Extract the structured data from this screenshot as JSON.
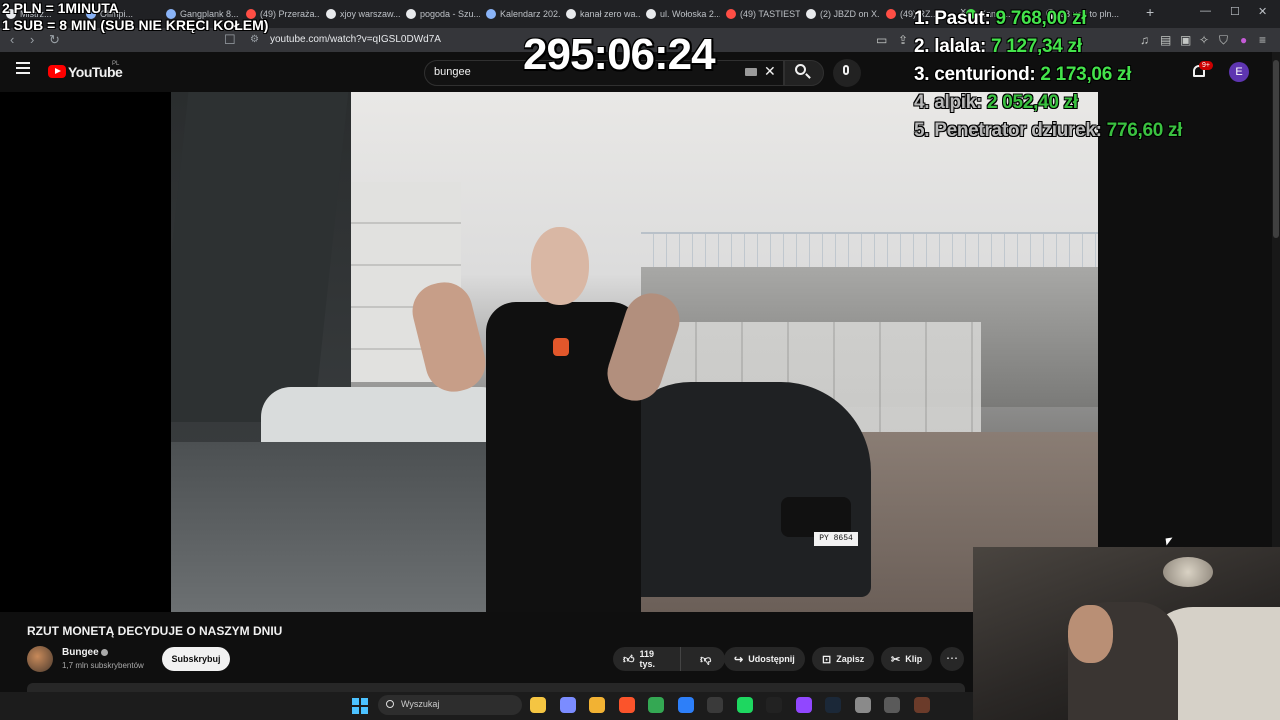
{
  "overlay": {
    "rate_line1": "2 PLN = 1MINUTA",
    "rate_line2": "1 SUB = 8 MIN (SUB NIE KRĘCI KOŁEM)",
    "timer": "295:06:24",
    "leaderboard": [
      {
        "name": "1. Pasut:",
        "amount": "9 768,00 zł"
      },
      {
        "name": "2. lalala:",
        "amount": "7 127,34 zł"
      },
      {
        "name": "3. centuriond:",
        "amount": "2 173,06 zł"
      },
      {
        "name": "4. alpik:",
        "amount": "2 052,40 zł"
      },
      {
        "name": "5. Penetrator dziurek:",
        "amount": "776,60 zł"
      }
    ]
  },
  "browser": {
    "tabs": [
      {
        "label": "Mistrz...",
        "color": "#e8eaed"
      },
      {
        "label": "Olimpi...",
        "color": "#8ab4f8"
      },
      {
        "label": "Gangplank 8...",
        "color": "#8ab4f8"
      },
      {
        "label": "(49) Przeraża...",
        "color": "#ff4e45"
      },
      {
        "label": "xjoy warszaw...",
        "color": "#e8eaed"
      },
      {
        "label": "pogoda - Szu...",
        "color": "#e8eaed"
      },
      {
        "label": "Kalendarz 202...",
        "color": "#8ab4f8"
      },
      {
        "label": "kanał zero wa...",
        "color": "#e8eaed"
      },
      {
        "label": "ul. Wołoska 2...",
        "color": "#e8eaed"
      },
      {
        "label": "(49) TASTIEST...",
        "color": "#ff4e45"
      },
      {
        "label": "(2) JBZD on X...",
        "color": "#e8eaed"
      },
      {
        "label": "(49) RZ...",
        "color": "#ff4e45"
      },
      {
        "label": "Kanał...",
        "color": "#44e34b"
      },
      {
        "label": "28 usd to pln...",
        "color": "#e8eaed"
      }
    ],
    "url": "youtube.com/watch?v=qIGSL0DWd7A"
  },
  "youtube": {
    "logo_text": "YouTube",
    "region": "PL",
    "search_value": "bungee",
    "notification_badge": "9+",
    "avatar_letter": "E"
  },
  "video": {
    "title": "RZUT MONETĄ DECYDUJE O NASZYM DNIU",
    "channel_name": "Bungee",
    "subscribers": "1,7 mln subskrybentów",
    "subscribe_label": "Subskrybuj",
    "likes": "119 tys.",
    "share_label": "Udostępnij",
    "save_label": "Zapisz",
    "clip_label": "Klip",
    "more_label": "⋯",
    "plate_text": "PY 8654"
  },
  "taskbar": {
    "search_placeholder": "Wyszukaj",
    "apps": [
      {
        "name": "file-explorer-icon",
        "color": "#f5c542"
      },
      {
        "name": "copilot-icon",
        "color": "#7b8cff"
      },
      {
        "name": "folder-icon",
        "color": "#f2b233"
      },
      {
        "name": "brave-icon",
        "color": "#fb542b"
      },
      {
        "name": "chrome-icon",
        "color": "#34a853"
      },
      {
        "name": "store-icon",
        "color": "#2d7ff9"
      },
      {
        "name": "obs-icon",
        "color": "#3a3a3a"
      },
      {
        "name": "spotify-icon",
        "color": "#1ed760"
      },
      {
        "name": "muza-icon",
        "color": "#222222"
      },
      {
        "name": "twitch-icon",
        "color": "#9147ff"
      },
      {
        "name": "steam-icon",
        "color": "#1b2838"
      },
      {
        "name": "settings-icon",
        "color": "#8a8a8a"
      },
      {
        "name": "calculator-icon",
        "color": "#5a5a5a"
      },
      {
        "name": "game-icon",
        "color": "#6b3b2a"
      }
    ]
  }
}
